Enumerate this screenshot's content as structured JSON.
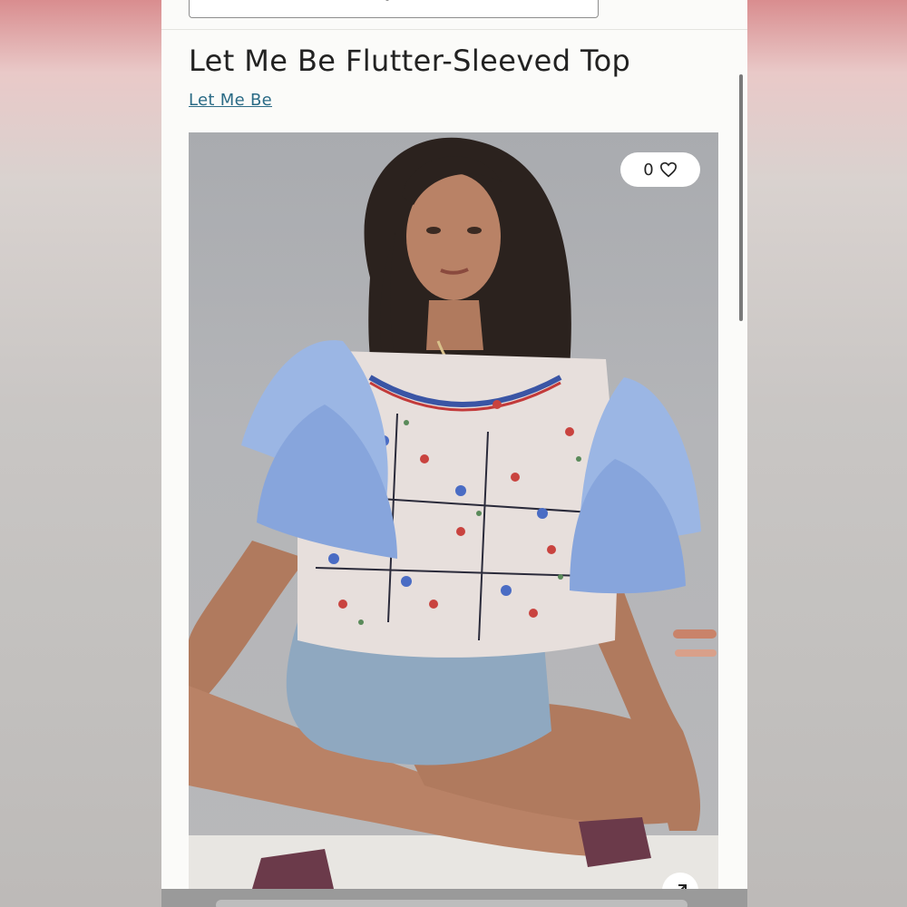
{
  "product": {
    "title": "Let Me Be Flutter-Sleeved Top",
    "brand": "Let Me Be"
  },
  "photo": {
    "like_count": "0",
    "like_icon": "heart-outline-icon",
    "expand_icon": "arrow-up-right-icon"
  },
  "colors": {
    "brand_link": "#2b6b86",
    "page_background": "#fbfbf9"
  }
}
